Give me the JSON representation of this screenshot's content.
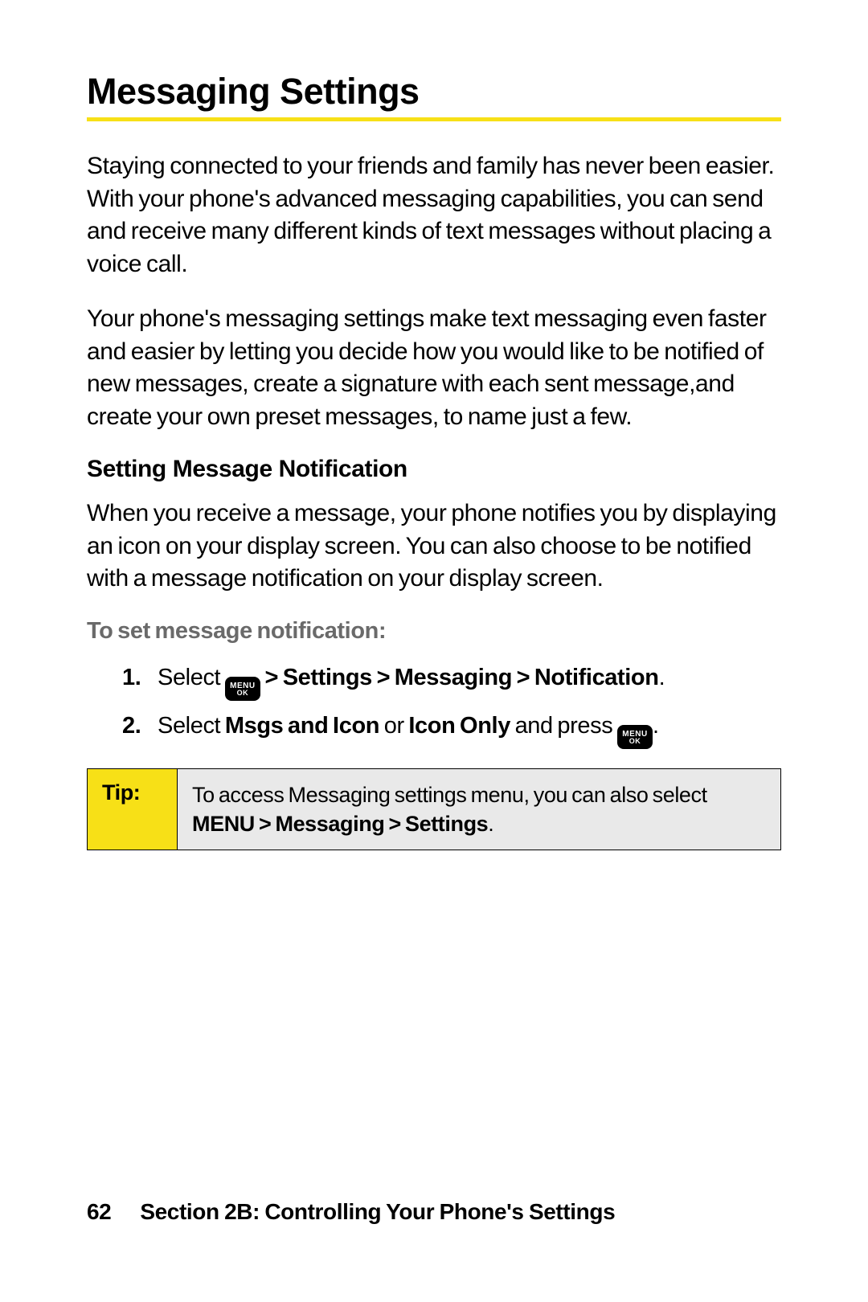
{
  "title": "Messaging Settings",
  "para1": "Staying connected to your friends and family has never been easier. With your phone's advanced messaging capabilities, you can send and receive many different kinds of text messages without placing a voice call.",
  "para2": "Your phone's messaging settings make text messaging even faster and easier by letting you decide how you would like to be notified of new messages, create a signature with each sent message,and create your own preset messages, to name just a few.",
  "subhead": "Setting Message Notification",
  "para3": "When you receive a message, your phone notifies you by displaying an icon on your display screen. You can also choose to be notified with a message notification on your display screen.",
  "leadin": "To set message notification:",
  "menu_key": {
    "line1": "MENU",
    "line2": "OK"
  },
  "steps": {
    "s1": {
      "num": "1.",
      "pre": "Select ",
      "path": " > Settings > Messaging > Notification",
      "post": "."
    },
    "s2": {
      "num": "2.",
      "pre": "Select ",
      "opt1": "Msgs and Icon",
      "mid": " or ",
      "opt2": "Icon Only",
      "post1": " and press ",
      "post2": "."
    }
  },
  "tip": {
    "label": "Tip:",
    "pre": "To access Messaging settings menu, you can also select ",
    "menu_word": "MENU",
    "path": " > Messaging > Settings",
    "post": "."
  },
  "footer": {
    "page": "62",
    "section": "Section 2B: Controlling Your Phone's Settings"
  }
}
